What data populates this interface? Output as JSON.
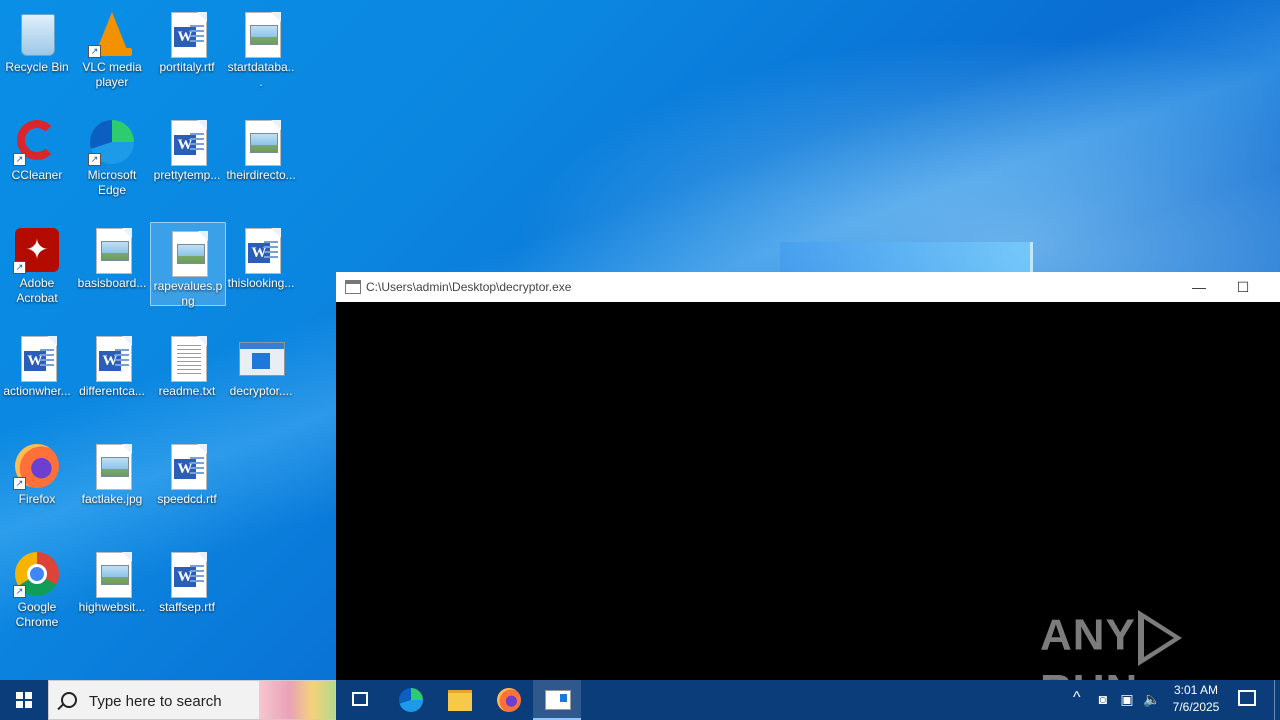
{
  "desktop_icons": [
    {
      "label": "Recycle Bin",
      "kind": "recycle"
    },
    {
      "label": "VLC media player",
      "kind": "vlc"
    },
    {
      "label": "portitaly.rtf",
      "kind": "word"
    },
    {
      "label": "startdataba...",
      "kind": "image"
    },
    {
      "label": "CCleaner",
      "kind": "ccleaner"
    },
    {
      "label": "Microsoft Edge",
      "kind": "edge"
    },
    {
      "label": "prettytemp...",
      "kind": "word"
    },
    {
      "label": "theirdirecto...",
      "kind": "image"
    },
    {
      "label": "Adobe Acrobat",
      "kind": "acrobat"
    },
    {
      "label": "basisboard...",
      "kind": "image"
    },
    {
      "label": "rapevalues.png",
      "kind": "image",
      "selected": true
    },
    {
      "label": "thislooking...",
      "kind": "word"
    },
    {
      "label": "actionwher...",
      "kind": "word"
    },
    {
      "label": "differentca...",
      "kind": "word"
    },
    {
      "label": "readme.txt",
      "kind": "text"
    },
    {
      "label": "decryptor....",
      "kind": "exe"
    },
    {
      "label": "Firefox",
      "kind": "firefox"
    },
    {
      "label": "factlake.jpg",
      "kind": "image"
    },
    {
      "label": "speedcd.rtf",
      "kind": "word"
    },
    {
      "label": "Google Chrome",
      "kind": "chrome"
    },
    {
      "label": "highwebsit...",
      "kind": "image"
    },
    {
      "label": "staffsep.rtf",
      "kind": "word"
    }
  ],
  "console_window": {
    "title": "C:\\Users\\admin\\Desktop\\decryptor.exe",
    "minimize_glyph": "—",
    "maximize_glyph": "☐"
  },
  "watermark": {
    "left": "ANY",
    "right": "RUN"
  },
  "taskbar": {
    "search_placeholder": "Type here to search",
    "clock_time": "3:01 AM",
    "clock_date": "7/6/2025"
  },
  "colors": {
    "taskbar": "#0b3d7a",
    "desktop": "#0a8fe6",
    "console_bg": "#000000"
  }
}
